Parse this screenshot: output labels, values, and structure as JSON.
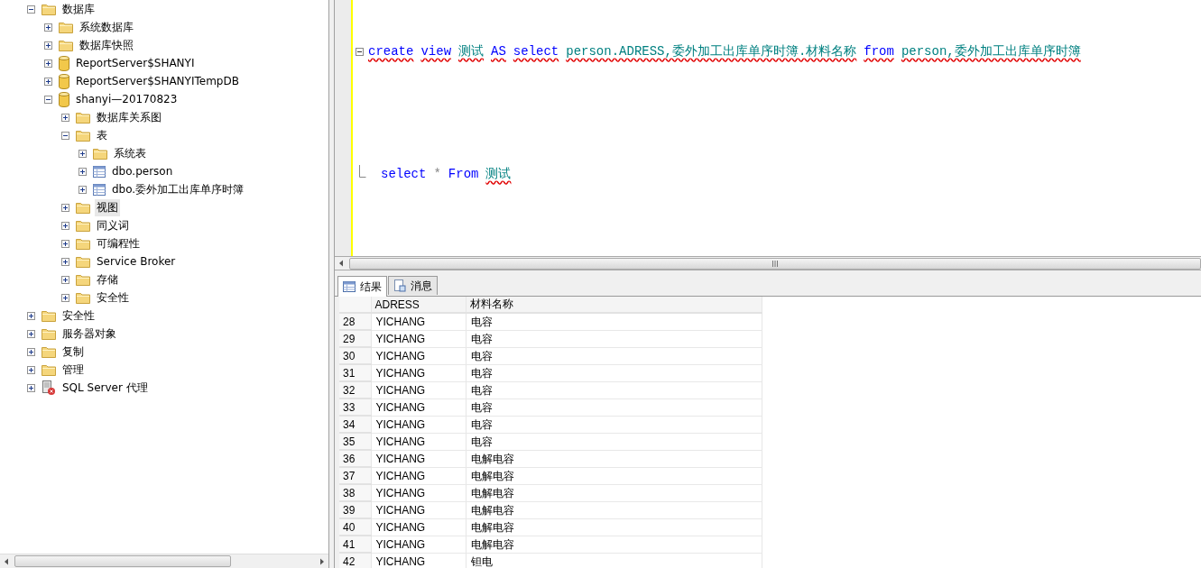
{
  "object_explorer": {
    "tree": [
      {
        "label": "数据库",
        "kind": "folder",
        "expanded": true,
        "selected": false,
        "children": [
          {
            "label": "系统数据库",
            "kind": "folder",
            "expanded": false,
            "selected": false
          },
          {
            "label": "数据库快照",
            "kind": "folder",
            "expanded": false,
            "selected": false
          },
          {
            "label": "ReportServer$SHANYI",
            "kind": "database",
            "expanded": false,
            "selected": false
          },
          {
            "label": "ReportServer$SHANYITempDB",
            "kind": "database",
            "expanded": false,
            "selected": false
          },
          {
            "label": "shanyi—20170823",
            "kind": "database",
            "expanded": true,
            "selected": false,
            "children": [
              {
                "label": "数据库关系图",
                "kind": "folder",
                "expanded": false,
                "selected": false
              },
              {
                "label": "表",
                "kind": "folder",
                "expanded": true,
                "selected": false,
                "children": [
                  {
                    "label": "系统表",
                    "kind": "folder",
                    "expanded": false,
                    "selected": false
                  },
                  {
                    "label": "dbo.person",
                    "kind": "table",
                    "expanded": false,
                    "selected": false
                  },
                  {
                    "label": "dbo.委外加工出库单序时簿",
                    "kind": "table",
                    "expanded": false,
                    "selected": false
                  }
                ]
              },
              {
                "label": "视图",
                "kind": "folder",
                "expanded": false,
                "selected": true
              },
              {
                "label": "同义词",
                "kind": "folder",
                "expanded": false,
                "selected": false
              },
              {
                "label": "可编程性",
                "kind": "folder",
                "expanded": false,
                "selected": false
              },
              {
                "label": "Service Broker",
                "kind": "folder",
                "expanded": false,
                "selected": false
              },
              {
                "label": "存储",
                "kind": "folder",
                "expanded": false,
                "selected": false
              },
              {
                "label": "安全性",
                "kind": "folder",
                "expanded": false,
                "selected": false
              }
            ]
          }
        ]
      },
      {
        "label": "安全性",
        "kind": "folder",
        "expanded": false,
        "selected": false
      },
      {
        "label": "服务器对象",
        "kind": "folder",
        "expanded": false,
        "selected": false
      },
      {
        "label": "复制",
        "kind": "folder",
        "expanded": false,
        "selected": false
      },
      {
        "label": "管理",
        "kind": "folder",
        "expanded": false,
        "selected": false
      },
      {
        "label": "SQL Server 代理",
        "kind": "agent",
        "expanded": false,
        "selected": false
      }
    ]
  },
  "editor": {
    "lines": [
      {
        "collapsible": true,
        "tokens": [
          {
            "text": "create",
            "kind": "keyword",
            "error": true
          },
          {
            "text": "view",
            "kind": "keyword",
            "error": true
          },
          {
            "text": "测试",
            "kind": "identifier",
            "error": true
          },
          {
            "text": "AS",
            "kind": "keyword",
            "error": true
          },
          {
            "text": "select",
            "kind": "keyword",
            "error": true
          },
          {
            "text": "person.ADRESS,委外加工出库单序时簿.材料名称",
            "kind": "identifier",
            "error": true
          },
          {
            "text": "from",
            "kind": "keyword",
            "error": true
          },
          {
            "text": "person,委外加工出库单序时簿",
            "kind": "identifier",
            "error": true
          }
        ]
      },
      {
        "collapsible": false,
        "tokens": [
          {
            "text": "select",
            "kind": "keyword",
            "error": false
          },
          {
            "text": "*",
            "kind": "operator",
            "error": false
          },
          {
            "text": "From",
            "kind": "keyword",
            "error": false
          },
          {
            "text": "测试",
            "kind": "identifier",
            "error": true
          }
        ]
      }
    ]
  },
  "result_tabs": [
    {
      "label": "结果",
      "kind": "grid",
      "selected": true
    },
    {
      "label": "消息",
      "kind": "messages",
      "selected": false
    }
  ],
  "results": {
    "columns": [
      "",
      "ADRESS",
      "材料名称"
    ],
    "rows": [
      [
        "28",
        "YICHANG",
        "电容"
      ],
      [
        "29",
        "YICHANG",
        "电容"
      ],
      [
        "30",
        "YICHANG",
        "电容"
      ],
      [
        "31",
        "YICHANG",
        "电容"
      ],
      [
        "32",
        "YICHANG",
        "电容"
      ],
      [
        "33",
        "YICHANG",
        "电容"
      ],
      [
        "34",
        "YICHANG",
        "电容"
      ],
      [
        "35",
        "YICHANG",
        "电容"
      ],
      [
        "36",
        "YICHANG",
        "电解电容"
      ],
      [
        "37",
        "YICHANG",
        "电解电容"
      ],
      [
        "38",
        "YICHANG",
        "电解电容"
      ],
      [
        "39",
        "YICHANG",
        "电解电容"
      ],
      [
        "40",
        "YICHANG",
        "电解电容"
      ],
      [
        "41",
        "YICHANG",
        "电解电容"
      ],
      [
        "42",
        "YICHANG",
        "钽电"
      ]
    ]
  }
}
